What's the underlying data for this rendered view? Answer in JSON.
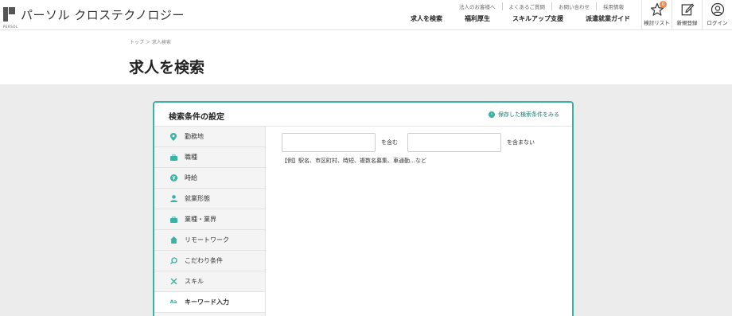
{
  "brand": {
    "logo_sub": "PERSOL",
    "name": "パーソル クロステクノロジー"
  },
  "util_nav": [
    "法人のお客様へ",
    "よくあるご質問",
    "お問い合わせ",
    "採用情報"
  ],
  "main_nav": [
    "求人を検索",
    "福利厚生",
    "スキルアップ支援",
    "派遣就業ガイド"
  ],
  "header_icons": {
    "favorites": {
      "label": "検討リスト",
      "count": "0"
    },
    "register": {
      "label": "新規登録"
    },
    "login": {
      "label": "ログイン"
    }
  },
  "breadcrumb": "トップ ＞ 求人検索",
  "page_title": "求人を検索",
  "panel": {
    "title": "検索条件の設定",
    "saved_link": "保存した検索条件をみる"
  },
  "sidebar": {
    "items": [
      {
        "label": "勤務地",
        "icon": "location-pin-icon"
      },
      {
        "label": "職種",
        "icon": "briefcase-icon"
      },
      {
        "label": "時給",
        "icon": "yen-coin-icon"
      },
      {
        "label": "就業形態",
        "icon": "person-icon"
      },
      {
        "label": "業種・業界",
        "icon": "briefcase-icon"
      },
      {
        "label": "リモートワーク",
        "icon": "house-icon"
      },
      {
        "label": "こだわり条件",
        "icon": "magnifier-icon"
      },
      {
        "label": "スキル",
        "icon": "tools-icon"
      },
      {
        "label": "キーワード入力",
        "icon": "aa-text-icon"
      }
    ],
    "active_index": 8
  },
  "keyword": {
    "include_value": "",
    "include_label": "を含む",
    "exclude_value": "",
    "exclude_label": "を含まない",
    "example": "【例】駅名、市区町村、時短、複数名募集、車通勤…など"
  },
  "colors": {
    "accent": "#3ab3a6",
    "badge": "#f08a4b"
  }
}
